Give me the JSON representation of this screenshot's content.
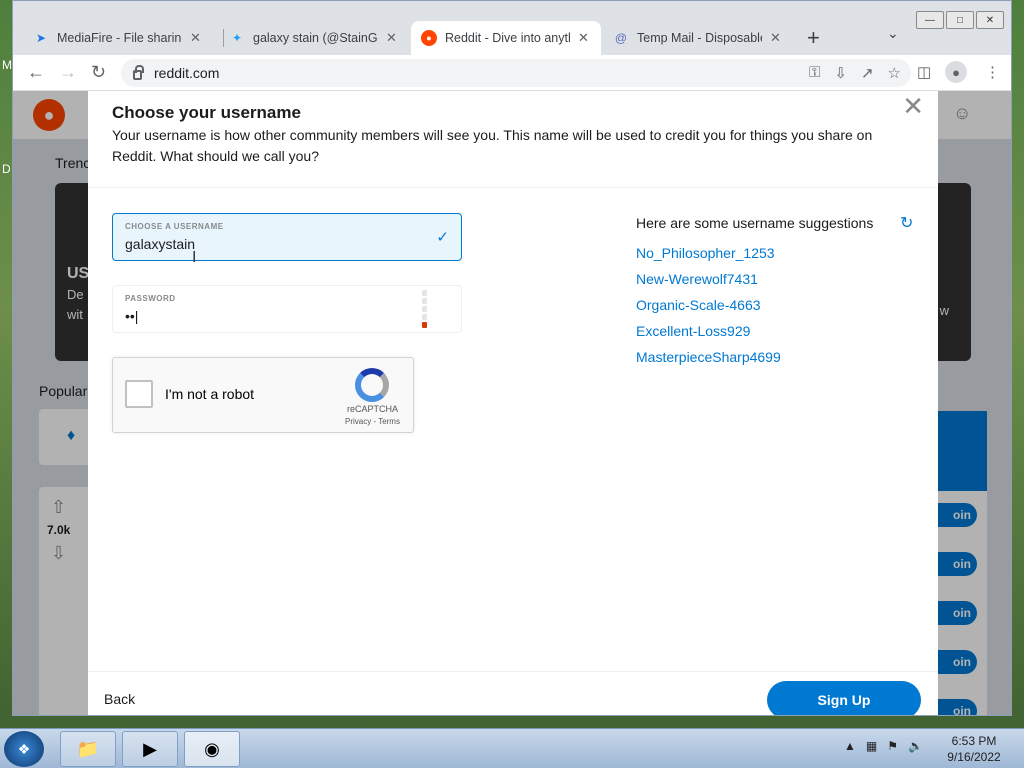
{
  "browser": {
    "tabs": [
      {
        "title": "MediaFire - File sharing",
        "favicon": "mediafire-icon",
        "active": false
      },
      {
        "title": "galaxy stain (@StainGala",
        "favicon": "twitter-icon",
        "active": false
      },
      {
        "title": "Reddit - Dive into anyth",
        "favicon": "reddit-icon",
        "active": true
      },
      {
        "title": "Temp Mail - Disposable",
        "favicon": "tempmail-icon",
        "active": false
      }
    ],
    "url": "reddit.com"
  },
  "page": {
    "trending_label": "Trenc",
    "trend_line1": "US",
    "trend_line2": "De",
    "trend_line3": "wit",
    "trend_right": "w",
    "popular_label": "Popular",
    "vote_count": "7.0k",
    "join_label": "oin"
  },
  "modal": {
    "title": "Choose your username",
    "subtitle": "Your username is how other community members will see you. This name will be used to credit you for things you share on Reddit. What should we call you?",
    "username": {
      "label": "CHOOSE A USERNAME",
      "value": "galaxystain"
    },
    "password": {
      "label": "PASSWORD",
      "value": "••|"
    },
    "captcha": {
      "label": "I'm not a robot",
      "brand": "reCAPTCHA",
      "links": "Privacy - Terms"
    },
    "suggestions_title": "Here are some username suggestions",
    "suggestions": [
      "No_Philosopher_1253",
      "New-Werewolf7431",
      "Organic-Scale-4663",
      "Excellent-Loss929",
      "MasterpieceSharp4699"
    ],
    "back_label": "Back",
    "signup_label": "Sign Up"
  },
  "desktop": {
    "edge_text_1": "M",
    "edge_text_2": "D"
  },
  "taskbar": {
    "time": "6:53 PM",
    "date": "9/16/2022"
  },
  "colors": {
    "reddit_blue": "#0079d3",
    "reddit_orange": "#ff4500"
  }
}
